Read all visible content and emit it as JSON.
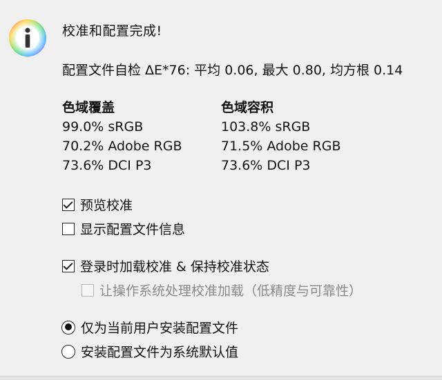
{
  "dialog": {
    "title": "校准和配置完成!",
    "summary": "配置文件自检 ΔE*76: 平均 0.06, 最大 0.80, 均方根 0.14",
    "coverage": {
      "heading": "色域覆盖",
      "rows": [
        "99.0% sRGB",
        "70.2% Adobe RGB",
        "73.6% DCI P3"
      ]
    },
    "volume": {
      "heading": "色域容积",
      "rows": [
        "103.8% sRGB",
        "71.5% Adobe RGB",
        "73.6% DCI P3"
      ]
    },
    "options": {
      "preview_calibration": {
        "label": "预览校准",
        "checked": true
      },
      "show_profile_info": {
        "label": "显示配置文件信息",
        "checked": false
      },
      "load_calibration_on_login": {
        "label": "登录时加载校准 & 保持校准状态",
        "checked": true
      },
      "let_os_handle": {
        "label": "让操作系统处理校准加载（低精度与可靠性）",
        "checked": false,
        "disabled": true
      }
    },
    "install": {
      "current_user": {
        "label": "仅为当前用户安装配置文件",
        "selected": true
      },
      "system_default": {
        "label": "安装配置文件为系统默认值",
        "selected": false
      }
    },
    "icon": "info-icon"
  }
}
